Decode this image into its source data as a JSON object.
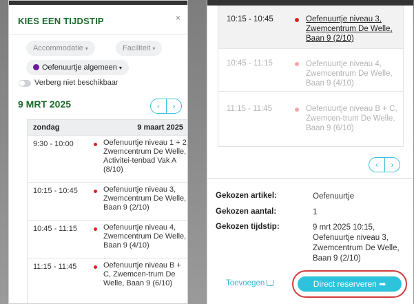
{
  "left_panel": {
    "title": "KIES EEN TIJDSTIP",
    "close_icon": "×",
    "filters": {
      "accommodatie": "Accommodatie",
      "faciliteit": "Faciliteit",
      "activity": "Oefenuurtje algemeen",
      "caret": "▾"
    },
    "toggle_label": "Verberg niet beschikbaar",
    "date_heading": "9 MRT 2025",
    "nav": {
      "prev": "‹",
      "next": "›"
    },
    "table": {
      "day": "zondag",
      "date": "9 maart 2025",
      "rows": [
        {
          "time": "9:30 - 10:00",
          "desc": "Oefenuurtje niveau 1 + 2, Zwemcentrum De Welle, Activitei-tenbad Vak A (8/10)"
        },
        {
          "time": "10:15 - 10:45",
          "desc": "Oefenuurtje niveau 3, Zwemcentrum De Welle, Baan 9 (2/10)"
        },
        {
          "time": "10:45 - 11:15",
          "desc": "Oefenuurtje niveau 4, Zwemcentrum De Welle, Baan 9 (4/10)"
        },
        {
          "time": "11:15 - 11:45",
          "desc": "Oefenuurtje niveau B + C, Zwemcen-trum De Welle, Baan 9 (6/10)"
        }
      ]
    }
  },
  "right_panel": {
    "rows": [
      {
        "time": "10:15 - 10:45",
        "desc": "Oefenuurtje niveau 3, Zwemcentrum De Welle, Baan 9 (2/10)",
        "state": "selected"
      },
      {
        "time": "10:45 - 11:15",
        "desc": "Oefenuurtje niveau 4, Zwemcentrum De Welle, Baan 9 (4/10)",
        "state": "unavailable"
      },
      {
        "time": "11:15 - 11:45",
        "desc": "Oefenuurtje niveau B + C, Zwemcen-trum De Welle, Baan 9 (6/10)",
        "state": "unavailable"
      }
    ],
    "nav": {
      "prev": "‹",
      "next": "›"
    },
    "summary": {
      "artikel_label": "Gekozen artikel:",
      "artikel_value": "Oefenuurtje",
      "aantal_label": "Gekozen aantal:",
      "aantal_value": "1",
      "tijdstip_label": "Gekozen tijdstip:",
      "tijdstip_value": "9 mrt 2025 10:15, Oefenuurtje niveau 3, Zwemcentrum De Welle, Baan 9 (2/10)"
    },
    "add_button": "Toevoegen",
    "reserve_button": "Direct reserveren ➡"
  },
  "colors": {
    "brand_green": "#1a6b2a",
    "accent_cyan": "#2ec3dd",
    "available_dot": "#e02020",
    "activity_dot": "#6a1b9a",
    "highlight_ring": "#d23a3a"
  }
}
